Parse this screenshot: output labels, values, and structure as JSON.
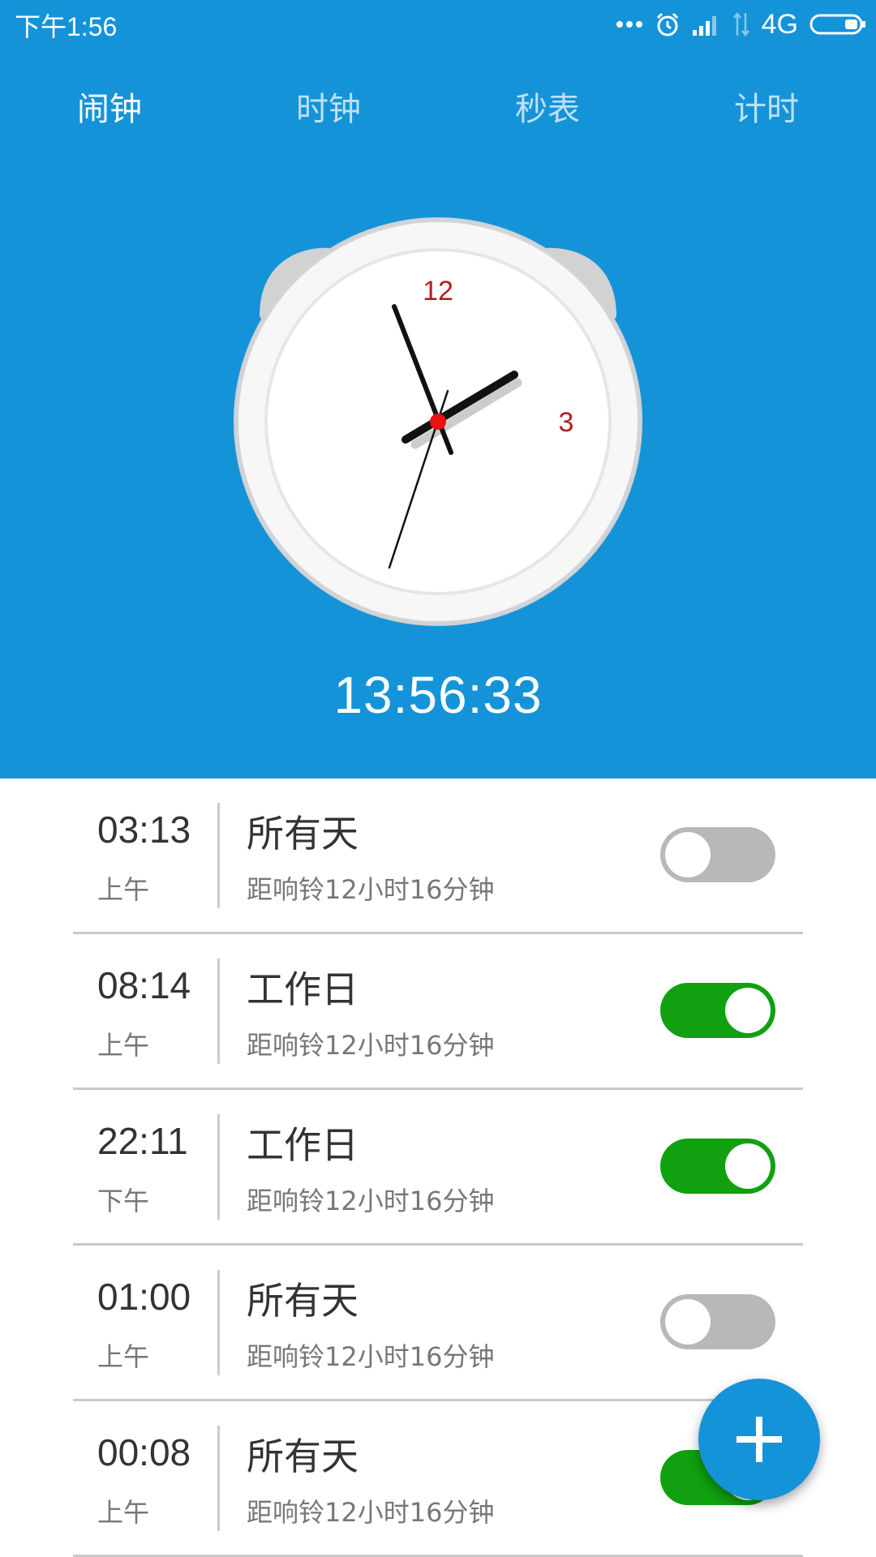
{
  "status_bar": {
    "time": "下午1:56",
    "network": "4G",
    "icons": [
      "more-dots-icon",
      "alarm-icon",
      "signal-icon",
      "data-arrows-icon",
      "battery-icon"
    ]
  },
  "tabs": [
    {
      "label": "闹钟",
      "active": true
    },
    {
      "label": "时钟",
      "active": false
    },
    {
      "label": "秒表",
      "active": false
    },
    {
      "label": "计时",
      "active": false
    }
  ],
  "clock": {
    "numeral_12": "12",
    "numeral_3": "3",
    "time_display": "13:56:33"
  },
  "alarms": [
    {
      "time": "03:13",
      "ampm": "上午",
      "repeat": "所有天",
      "remaining": "距响铃12小时16分钟",
      "enabled": false
    },
    {
      "time": "08:14",
      "ampm": "上午",
      "repeat": "工作日",
      "remaining": "距响铃12小时16分钟",
      "enabled": true
    },
    {
      "time": "22:11",
      "ampm": "下午",
      "repeat": "工作日",
      "remaining": "距响铃12小时16分钟",
      "enabled": true
    },
    {
      "time": "01:00",
      "ampm": "上午",
      "repeat": "所有天",
      "remaining": "距响铃12小时16分钟",
      "enabled": false
    },
    {
      "time": "00:08",
      "ampm": "上午",
      "repeat": "所有天",
      "remaining": "距响铃12小时16分钟",
      "enabled": true
    }
  ],
  "fab": {
    "icon": "plus-icon"
  },
  "colors": {
    "header": "#1593d9",
    "toggle_on": "#10a010",
    "toggle_off": "#b8b8b8",
    "numeral": "#b02020"
  }
}
